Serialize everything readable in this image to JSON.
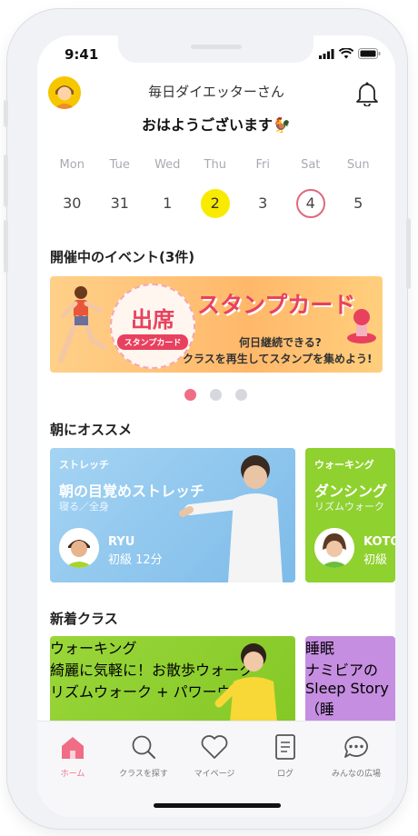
{
  "status": {
    "time": "9:41"
  },
  "header": {
    "username": "毎日ダイエッターさん",
    "greeting": "おはようございます🐓"
  },
  "week": [
    {
      "name": "Mon",
      "num": "30"
    },
    {
      "name": "Tue",
      "num": "31"
    },
    {
      "name": "Wed",
      "num": "1"
    },
    {
      "name": "Thu",
      "num": "2"
    },
    {
      "name": "Fri",
      "num": "3"
    },
    {
      "name": "Sat",
      "num": "4"
    },
    {
      "name": "Sun",
      "num": "5"
    }
  ],
  "events": {
    "title": "開催中のイベント(3件)",
    "banner": {
      "badge_main": "出席",
      "badge_sub": "スタンプカード",
      "headline": "スタンプカード",
      "line1": "何日継続できる?",
      "line2": "クラスを再生してスタンプを集めよう!"
    }
  },
  "morning": {
    "title": "朝にオススメ",
    "cards": [
      {
        "category": "ストレッチ",
        "title": "朝の目覚めストレッチ",
        "sub": "寝る／全身",
        "instructor": "RYU",
        "level": "初級 12分"
      },
      {
        "category": "ウォーキング",
        "title": "ダンシング",
        "sub": "リズムウォーク",
        "instructor": "KOTO",
        "level": "初級"
      }
    ]
  },
  "new_classes": {
    "title": "新着クラス",
    "cards": [
      {
        "category": "ウォーキング",
        "title": "綺麗に気軽に！お散歩ウォーク",
        "sub": "リズムウォーク + パワーウォーク"
      },
      {
        "category": "睡眠",
        "title": "ナミビアの",
        "sub": "Sleep Story（睡"
      }
    ]
  },
  "tabs": [
    {
      "label": "ホーム",
      "icon": "home-icon"
    },
    {
      "label": "クラスを探す",
      "icon": "search-icon"
    },
    {
      "label": "マイページ",
      "icon": "heart-icon"
    },
    {
      "label": "ログ",
      "icon": "log-icon"
    },
    {
      "label": "みんなの広場",
      "icon": "chat-icon"
    }
  ],
  "colors": {
    "accent": "#f06d85",
    "today": "#f8ea00",
    "stretch_card": "#8fc6ee",
    "walking_card": "#93d32f",
    "sleep_card": "#c58ee0"
  }
}
